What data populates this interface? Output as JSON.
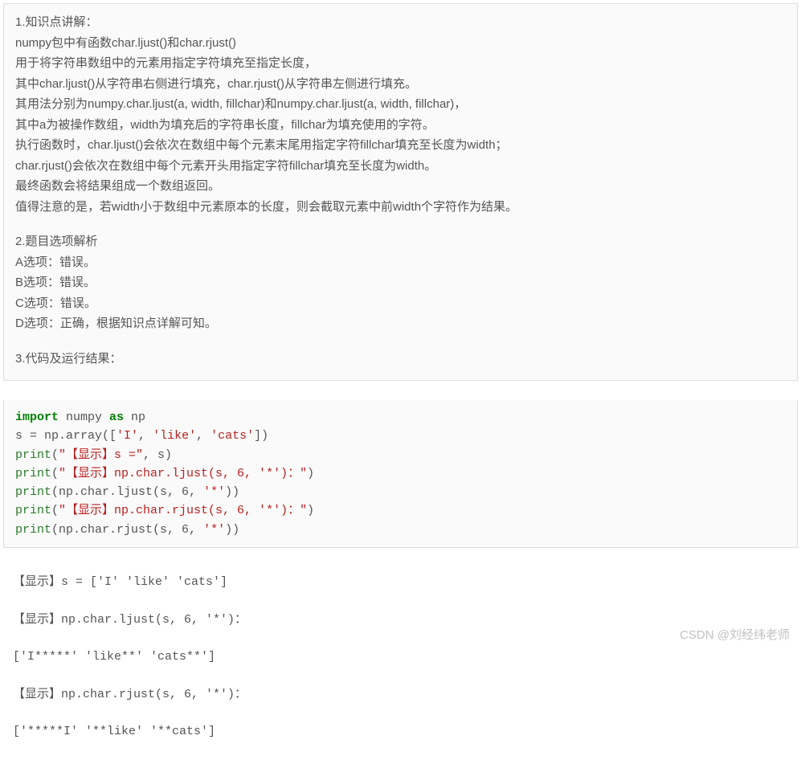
{
  "block1": {
    "l1": "1.知识点讲解：",
    "l2": "numpy包中有函数char.ljust()和char.rjust()",
    "l3": "用于将字符串数组中的元素用指定字符填充至指定长度，",
    "l4": "其中char.ljust()从字符串右侧进行填充，char.rjust()从字符串左侧进行填充。",
    "l5": "其用法分别为numpy.char.ljust(a, width, fillchar)和numpy.char.ljust(a, width, fillchar)，",
    "l6": "其中a为被操作数组，width为填充后的字符串长度，fillchar为填充使用的字符。",
    "l7": "执行函数时，char.ljust()会依次在数组中每个元素末尾用指定字符fillchar填充至长度为width；",
    "l8": "char.rjust()会依次在数组中每个元素开头用指定字符fillchar填充至长度为width。",
    "l9": "最终函数会将结果组成一个数组返回。",
    "l10": "值得注意的是，若width小于数组中元素原本的长度，则会截取元素中前width个字符作为结果。",
    "l11": "2.题目选项解析",
    "l12": "A选项：错误。",
    "l13": "B选项：错误。",
    "l14": "C选项：错误。",
    "l15": "D选项：正确，根据知识点详解可知。",
    "l16": "3.代码及运行结果："
  },
  "code": {
    "kw_import": "import",
    "kw_as": "as",
    "numpy": " numpy ",
    "np": " np",
    "l2a": "s = np.array([",
    "l2b": "'I'",
    "l2c": ", ",
    "l2d": "'like'",
    "l2e": ", ",
    "l2f": "'cats'",
    "l2g": "])",
    "print": "print",
    "s1": "\"【显示】s =\"",
    "s1b": ", s)",
    "s2": "\"【显示】np.char.ljust(s, 6, '*')：\"",
    "s2b": ")",
    "l5a": "(np.char.ljust(s, ",
    "six": "6",
    "l5b": ", ",
    "star": "'*'",
    "l5c": "))",
    "s3": "\"【显示】np.char.rjust(s, 6, '*')：\"",
    "s3b": ")",
    "l7a": "(np.char.rjust(s, ",
    "op": "("
  },
  "output": {
    "o1": "【显示】s = ['I' 'like' 'cats']",
    "o2": "【显示】np.char.ljust(s, 6, '*')：",
    "o3": "['I*****' 'like**' 'cats**']",
    "o4": "【显示】np.char.rjust(s, 6, '*')：",
    "o5": "['*****I' '**like' '**cats']"
  },
  "watermark": "CSDN @刘经纬老师"
}
